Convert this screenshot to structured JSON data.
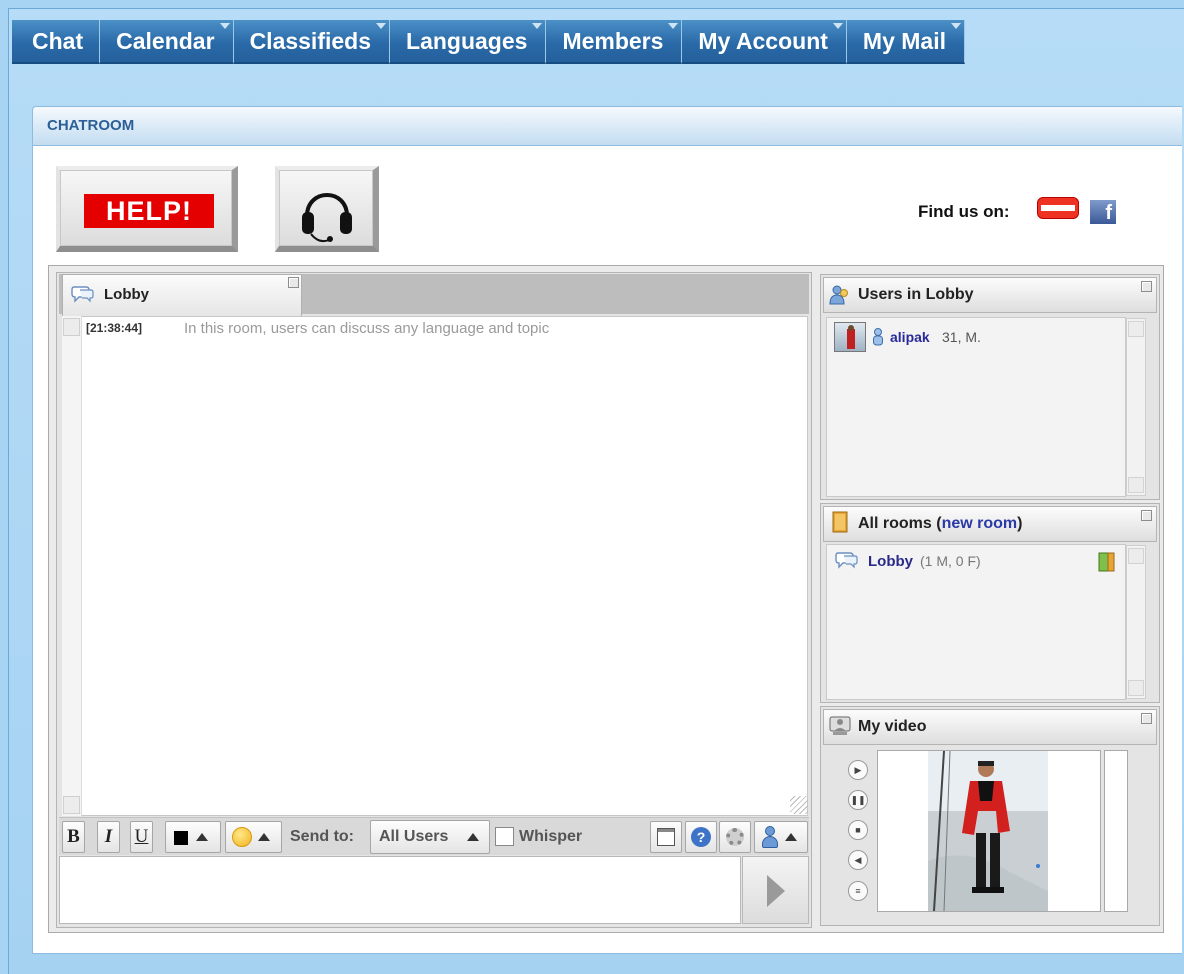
{
  "nav": {
    "items": [
      "Chat",
      "Calendar",
      "Classifieds",
      "Languages",
      "Members",
      "My Account",
      "My Mail"
    ]
  },
  "panel": {
    "title": "CHATROOM"
  },
  "buttons": {
    "help_label": "HELP!",
    "headset_icon": "headset-icon"
  },
  "social": {
    "find_us_label": "Find us on:",
    "icons": [
      "flag-icon",
      "facebook-icon"
    ]
  },
  "lobby": {
    "tab_label": "Lobby",
    "messages": [
      {
        "time": "[21:38:44]",
        "text": "In this room, users can discuss any language and topic"
      }
    ]
  },
  "toolbar": {
    "bold": "B",
    "italic": "I",
    "underline": "U",
    "send_to_label": "Send to:",
    "send_to_value": "All Users",
    "whisper_label": "Whisper",
    "whisper_checked": false
  },
  "users_panel": {
    "title": "Users in Lobby",
    "users": [
      {
        "name": "alipak",
        "meta": "31, M."
      }
    ]
  },
  "rooms_panel": {
    "title_prefix": "All rooms (",
    "new_room_link": "new room",
    "title_suffix": ")",
    "rooms": [
      {
        "name": "Lobby",
        "meta": "(1 M, 0 F)"
      }
    ]
  },
  "video_panel": {
    "title": "My video",
    "controls": [
      "play-icon",
      "pause-icon",
      "stop-icon",
      "volume-icon",
      "settings-icon"
    ]
  },
  "colors": {
    "nav_bg": "#2a6aa8",
    "page_bg": "#a8d4f4",
    "help_red": "#e40000",
    "link_blue": "#2a3aa6"
  }
}
